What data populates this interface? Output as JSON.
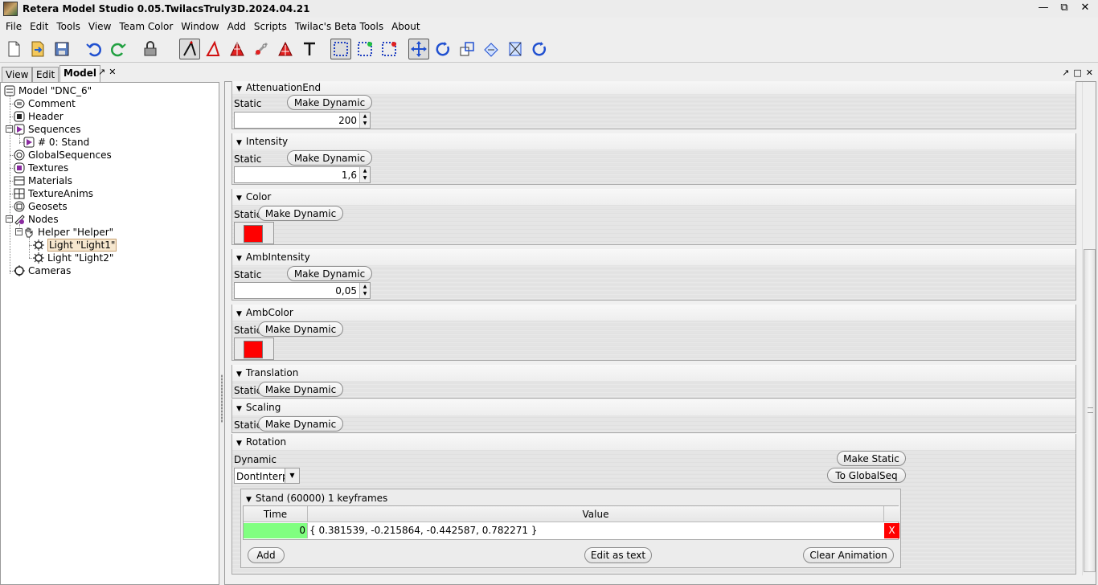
{
  "window": {
    "title": "Retera Model Studio 0.05.TwilacsTruly3D.2024.04.21",
    "controls": [
      "—",
      "⧉",
      "✕"
    ]
  },
  "menu": [
    "File",
    "Edit",
    "Tools",
    "View",
    "Team Color",
    "Window",
    "Add",
    "Scripts",
    "Twilac's Beta Tools",
    "About"
  ],
  "toolbar_icons": [
    "new-file-icon",
    "open-file-icon",
    "save-icon",
    "undo-icon",
    "redo-icon",
    "lock-icon",
    "select-vertex-icon",
    "select-face-icon",
    "select-group-icon",
    "select-cluster-icon",
    "select-bone-icon",
    "text-icon",
    "select-mode-icon",
    "add-select-icon",
    "deselect-icon",
    "move-icon",
    "rotate-icon",
    "scale-icon",
    "extrude-icon",
    "extend-icon",
    "rotate-normal-icon"
  ],
  "left_panel": {
    "tabs": [
      "View",
      "Edit",
      "Model"
    ],
    "tab_controls": [
      "↗",
      "✕"
    ],
    "tree": [
      {
        "label": "Model \"DNC_6\"",
        "icon": "model-icon"
      },
      {
        "label": "Comment",
        "icon": "comment-icon"
      },
      {
        "label": "Header",
        "icon": "header-icon"
      },
      {
        "label": "Sequences",
        "icon": "sequences-icon"
      },
      {
        "label": "# 0: Stand",
        "icon": "sequence-play-icon"
      },
      {
        "label": "GlobalSequences",
        "icon": "global-sequences-icon"
      },
      {
        "label": "Textures",
        "icon": "textures-icon"
      },
      {
        "label": "Materials",
        "icon": "materials-icon"
      },
      {
        "label": "TextureAnims",
        "icon": "texture-anims-icon"
      },
      {
        "label": "Geosets",
        "icon": "geosets-icon"
      },
      {
        "label": "Nodes",
        "icon": "nodes-icon"
      },
      {
        "label": "Helper \"Helper\"",
        "icon": "helper-icon"
      },
      {
        "label": "Light \"Light1\"",
        "icon": "light-icon",
        "selected": true
      },
      {
        "label": "Light \"Light2\"",
        "icon": "light-icon"
      },
      {
        "label": "Cameras",
        "icon": "cameras-icon"
      }
    ]
  },
  "right_panel": {
    "controls": [
      "↗",
      "□",
      "✕"
    ],
    "sections": [
      {
        "title": "AttenuationEnd",
        "mode": "Static",
        "button": "Make Dynamic",
        "value": "200"
      },
      {
        "title": "Intensity",
        "mode": "Static",
        "button": "Make Dynamic",
        "value": "1,6"
      },
      {
        "title": "Color",
        "mode": "Static",
        "button": "Make Dynamic",
        "color": "#ff0000"
      },
      {
        "title": "AmbIntensity",
        "mode": "Static",
        "button": "Make Dynamic",
        "value": "0,05"
      },
      {
        "title": "AmbColor",
        "mode": "Static",
        "button": "Make Dynamic",
        "color": "#ff0000"
      },
      {
        "title": "Translation",
        "mode": "Static",
        "button": "Make Dynamic"
      },
      {
        "title": "Scaling",
        "mode": "Static",
        "button": "Make Dynamic"
      }
    ],
    "rotation": {
      "title": "Rotation",
      "mode": "Dynamic",
      "interp": "DontInterp",
      "make_static": "Make Static",
      "to_global_seq": "To GlobalSeq",
      "keyframes": {
        "title": "Stand (60000) 1 keyframes",
        "headers": [
          "Time",
          "Value"
        ],
        "rows": [
          {
            "time": "0",
            "value": "{ 0.381539, -0.215864, -0.442587, 0.782271 }",
            "delete": "X"
          }
        ],
        "add": "Add",
        "edit_as_text": "Edit as text",
        "clear": "Clear Animation"
      }
    }
  },
  "colors": {
    "time_cell": "#80ff80",
    "delete_cell": "#ff0000",
    "selected_node": "#f6e7cf"
  }
}
